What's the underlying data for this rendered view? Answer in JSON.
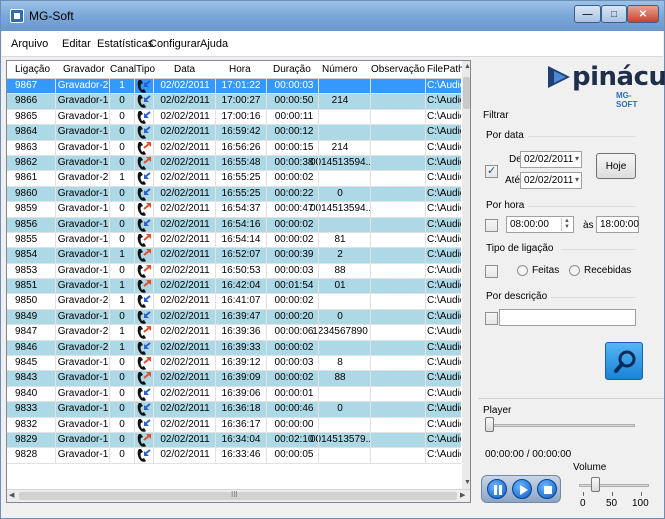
{
  "window": {
    "title": "MG-Soft"
  },
  "menu": [
    "Arquivo",
    "Editar",
    "Estatísticas",
    "Configurar",
    "Ajuda"
  ],
  "grid": {
    "columns": [
      "Ligação",
      "Gravador",
      "Canal",
      "Tipo",
      "Data",
      "Hora",
      "Duração",
      "Número",
      "Observação",
      "FilePath"
    ],
    "rows": [
      {
        "lig": "9867",
        "grav": "Gravador-2",
        "can": "1",
        "tipo": "in",
        "data": "02/02/2011",
        "hora": "17:01:22",
        "dur": "00:00:03",
        "num": "",
        "obs": "",
        "fp": "C:\\Audios\\201"
      },
      {
        "lig": "9866",
        "grav": "Gravador-1",
        "can": "0",
        "tipo": "in",
        "data": "02/02/2011",
        "hora": "17:00:27",
        "dur": "00:00:50",
        "num": "214",
        "obs": "",
        "fp": "C:\\Audios\\201"
      },
      {
        "lig": "9865",
        "grav": "Gravador-1",
        "can": "0",
        "tipo": "in",
        "data": "02/02/2011",
        "hora": "17:00:16",
        "dur": "00:00:11",
        "num": "",
        "obs": "",
        "fp": "C:\\Audios\\201"
      },
      {
        "lig": "9864",
        "grav": "Gravador-1",
        "can": "0",
        "tipo": "in",
        "data": "02/02/2011",
        "hora": "16:59:42",
        "dur": "00:00:12",
        "num": "",
        "obs": "",
        "fp": "C:\\Audios\\201"
      },
      {
        "lig": "9863",
        "grav": "Gravador-1",
        "can": "0",
        "tipo": "out",
        "data": "02/02/2011",
        "hora": "16:56:26",
        "dur": "00:00:15",
        "num": "214",
        "obs": "",
        "fp": "C:\\Audios\\201"
      },
      {
        "lig": "9862",
        "grav": "Gravador-1",
        "can": "0",
        "tipo": "out",
        "data": "02/02/2011",
        "hora": "16:55:48",
        "dur": "00:00:38",
        "num": "0014513594...",
        "obs": "",
        "fp": "C:\\Audios\\201"
      },
      {
        "lig": "9861",
        "grav": "Gravador-2",
        "can": "1",
        "tipo": "in",
        "data": "02/02/2011",
        "hora": "16:55:25",
        "dur": "00:00:02",
        "num": "",
        "obs": "",
        "fp": "C:\\Audios\\201"
      },
      {
        "lig": "9860",
        "grav": "Gravador-1",
        "can": "0",
        "tipo": "in",
        "data": "02/02/2011",
        "hora": "16:55:25",
        "dur": "00:00:22",
        "num": "0",
        "obs": "",
        "fp": "C:\\Audios\\201"
      },
      {
        "lig": "9859",
        "grav": "Gravador-1",
        "can": "0",
        "tipo": "out",
        "data": "02/02/2011",
        "hora": "16:54:37",
        "dur": "00:00:47",
        "num": "0014513594...",
        "obs": "",
        "fp": "C:\\Audios\\201"
      },
      {
        "lig": "9856",
        "grav": "Gravador-1",
        "can": "0",
        "tipo": "in",
        "data": "02/02/2011",
        "hora": "16:54:16",
        "dur": "00:00:02",
        "num": "",
        "obs": "",
        "fp": "C:\\Audios\\201"
      },
      {
        "lig": "9855",
        "grav": "Gravador-1",
        "can": "0",
        "tipo": "out",
        "data": "02/02/2011",
        "hora": "16:54:14",
        "dur": "00:00:02",
        "num": "81",
        "obs": "",
        "fp": "C:\\Audios\\201"
      },
      {
        "lig": "9854",
        "grav": "Gravador-1",
        "can": "1",
        "tipo": "out",
        "data": "02/02/2011",
        "hora": "16:52:07",
        "dur": "00:00:39",
        "num": "2",
        "obs": "",
        "fp": "C:\\Audios\\201"
      },
      {
        "lig": "9853",
        "grav": "Gravador-1",
        "can": "0",
        "tipo": "out",
        "data": "02/02/2011",
        "hora": "16:50:53",
        "dur": "00:00:03",
        "num": "88",
        "obs": "",
        "fp": "C:\\Audios\\201"
      },
      {
        "lig": "9851",
        "grav": "Gravador-1",
        "can": "1",
        "tipo": "out",
        "data": "02/02/2011",
        "hora": "16:42:04",
        "dur": "00:01:54",
        "num": "01",
        "obs": "",
        "fp": "C:\\Audios\\201"
      },
      {
        "lig": "9850",
        "grav": "Gravador-2",
        "can": "1",
        "tipo": "in",
        "data": "02/02/2011",
        "hora": "16:41:07",
        "dur": "00:00:02",
        "num": "",
        "obs": "",
        "fp": "C:\\Audios\\201"
      },
      {
        "lig": "9849",
        "grav": "Gravador-1",
        "can": "0",
        "tipo": "in",
        "data": "02/02/2011",
        "hora": "16:39:47",
        "dur": "00:00:20",
        "num": "0",
        "obs": "",
        "fp": "C:\\Audios\\201"
      },
      {
        "lig": "9847",
        "grav": "Gravador-2",
        "can": "1",
        "tipo": "out",
        "data": "02/02/2011",
        "hora": "16:39:36",
        "dur": "00:00:06",
        "num": "1234567890",
        "obs": "",
        "fp": "C:\\Audios\\201"
      },
      {
        "lig": "9846",
        "grav": "Gravador-2",
        "can": "1",
        "tipo": "in",
        "data": "02/02/2011",
        "hora": "16:39:33",
        "dur": "00:00:02",
        "num": "",
        "obs": "",
        "fp": "C:\\Audios\\201"
      },
      {
        "lig": "9845",
        "grav": "Gravador-1",
        "can": "0",
        "tipo": "out",
        "data": "02/02/2011",
        "hora": "16:39:12",
        "dur": "00:00:03",
        "num": "8",
        "obs": "",
        "fp": "C:\\Audios\\201"
      },
      {
        "lig": "9843",
        "grav": "Gravador-1",
        "can": "0",
        "tipo": "out",
        "data": "02/02/2011",
        "hora": "16:39:09",
        "dur": "00:00:02",
        "num": "88",
        "obs": "",
        "fp": "C:\\Audios\\201"
      },
      {
        "lig": "9840",
        "grav": "Gravador-1",
        "can": "0",
        "tipo": "in",
        "data": "02/02/2011",
        "hora": "16:39:06",
        "dur": "00:00:01",
        "num": "",
        "obs": "",
        "fp": "C:\\Audios\\201"
      },
      {
        "lig": "9833",
        "grav": "Gravador-1",
        "can": "0",
        "tipo": "in",
        "data": "02/02/2011",
        "hora": "16:36:18",
        "dur": "00:00:46",
        "num": "0",
        "obs": "",
        "fp": "C:\\Audios\\201"
      },
      {
        "lig": "9832",
        "grav": "Gravador-1",
        "can": "0",
        "tipo": "in",
        "data": "02/02/2011",
        "hora": "16:36:17",
        "dur": "00:00:00",
        "num": "",
        "obs": "",
        "fp": "C:\\Audios\\201"
      },
      {
        "lig": "9829",
        "grav": "Gravador-1",
        "can": "0",
        "tipo": "out",
        "data": "02/02/2011",
        "hora": "16:34:04",
        "dur": "00:02:10",
        "num": "0014513579...",
        "obs": "",
        "fp": "C:\\Audios\\201"
      },
      {
        "lig": "9828",
        "grav": "Gravador-1",
        "can": "0",
        "tipo": "in",
        "data": "02/02/2011",
        "hora": "16:33:46",
        "dur": "00:00:05",
        "num": "",
        "obs": "",
        "fp": "C:\\Audios\\201"
      }
    ],
    "hscroll_label": "III"
  },
  "logo": {
    "name": "pináculo",
    "sub": "MG-SOFT"
  },
  "filter": {
    "title": "Filtrar",
    "por_data": "Por data",
    "de_label": "De",
    "de_value": "02/02/2011",
    "ate_label": "Até",
    "ate_value": "02/02/2011",
    "hoje": "Hoje",
    "por_hora": "Por hora",
    "hora_de": "08:00:00",
    "as_label": "às",
    "hora_ate": "18:00:00",
    "tipo_label": "Tipo de ligação",
    "feitas": "Feitas",
    "recebidas": "Recebidas",
    "descricao_label": "Por descrição",
    "descricao_value": ""
  },
  "player": {
    "title": "Player",
    "time": "00:00:00 / 00:00:00",
    "position": 0,
    "volume_label": "Volume",
    "volume_ticks": [
      "0",
      "50",
      "100"
    ],
    "volume": 20
  },
  "colors": {
    "selection": "#3399ff",
    "row_alt": "#add8e6",
    "incoming_arrow": "#2a62c9",
    "outgoing_arrow": "#e0502a"
  }
}
